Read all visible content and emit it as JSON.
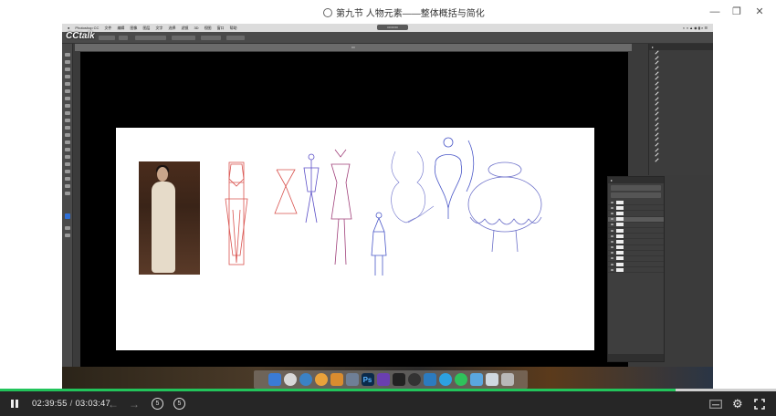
{
  "window": {
    "title": "第九节 人物元素——整体概括与简化",
    "minimize_glyph": "—",
    "restore_glyph": "❐",
    "close_glyph": "✕"
  },
  "video": {
    "watermark": "CCtalk",
    "mac_menu": [
      "Photoshop CC",
      "文件",
      "编辑",
      "图像",
      "图层",
      "文字",
      "选择",
      "滤镜",
      "3D",
      "视图",
      "窗口",
      "帮助"
    ],
    "clock_chip": "00:00:00"
  },
  "player": {
    "current_time": "02:39:55",
    "separator": "/",
    "duration": "03:03:47",
    "progress_fraction": 0.871,
    "rewind_label": "5",
    "forward_label": "5",
    "accent_color": "#22c45b"
  },
  "icons": {
    "pause": "pause-icon",
    "prev": "arrow-left-icon",
    "next": "arrow-right-icon",
    "subtitle": "subtitle-icon",
    "settings": "gear-icon",
    "fullscreen": "fullscreen-icon"
  }
}
